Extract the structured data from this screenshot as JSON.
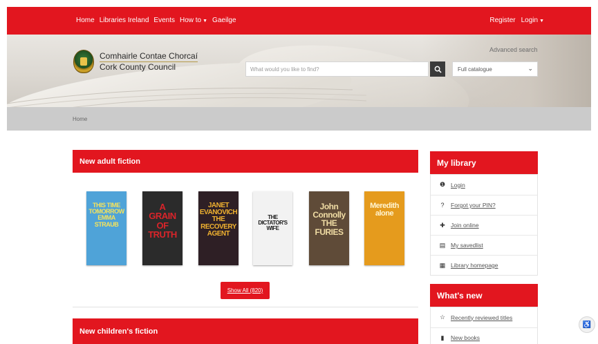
{
  "nav": {
    "left": [
      "Home",
      "Libraries Ireland",
      "Events",
      "How to",
      "Gaeilge"
    ],
    "right": [
      "Register",
      "Login"
    ]
  },
  "header": {
    "logo_irish": "Comhairle Contae Chorcaí",
    "logo_english": "Cork County Council",
    "advanced_search": "Advanced search",
    "search_placeholder": "What would you like to find?",
    "catalogue_selected": "Full catalogue"
  },
  "breadcrumb": "Home",
  "adult_fiction": {
    "title": "New adult fiction",
    "books": [
      {
        "lines": [
          "THIS TIME",
          "TOMORROW",
          "EMMA",
          "STRAUB"
        ],
        "bg": "#4fa3d8",
        "fg": "#f6e35b"
      },
      {
        "lines": [
          "A",
          "GRAIN",
          "OF",
          "TRUTH"
        ],
        "bg": "#2b2b2b",
        "fg": "#d9242a"
      },
      {
        "lines": [
          "JANET",
          "EVANOVICH",
          "THE",
          "RECOVERY",
          "AGENT"
        ],
        "bg": "#2e1f25",
        "fg": "#f1b230"
      },
      {
        "lines": [
          "THE",
          "DICTATOR'S",
          "WIFE"
        ],
        "bg": "#f2f2f2",
        "fg": "#1b1b1b"
      },
      {
        "lines": [
          "John",
          "Connolly",
          "THE",
          "FURIES"
        ],
        "bg": "#5f4b38",
        "fg": "#f0dca4"
      },
      {
        "lines": [
          "Meredith",
          "alone"
        ],
        "bg": "#e59b1d",
        "fg": "#fff4d0"
      }
    ],
    "show_all": "Show All (820)"
  },
  "children_fiction": {
    "title": "New children's fiction"
  },
  "my_library": {
    "title": "My library",
    "items": [
      {
        "icon": "user-icon",
        "glyph": "❶",
        "label": "Login"
      },
      {
        "icon": "question-icon",
        "glyph": "?",
        "label": "Forgot your PIN?"
      },
      {
        "icon": "add-user-icon",
        "glyph": "✚",
        "label": "Join online"
      },
      {
        "icon": "list-icon",
        "glyph": "▤",
        "label": "My savedlist"
      },
      {
        "icon": "library-icon",
        "glyph": "▦",
        "label": "Library homepage"
      }
    ]
  },
  "whats_new": {
    "title": "What's new",
    "items": [
      {
        "icon": "star-icon",
        "glyph": "☆",
        "label": "Recently reviewed titles"
      },
      {
        "icon": "book-icon",
        "glyph": "▮",
        "label": "New books"
      }
    ]
  },
  "colors": {
    "brand_red": "#e2161f",
    "band_grey": "#cbcbcb"
  }
}
